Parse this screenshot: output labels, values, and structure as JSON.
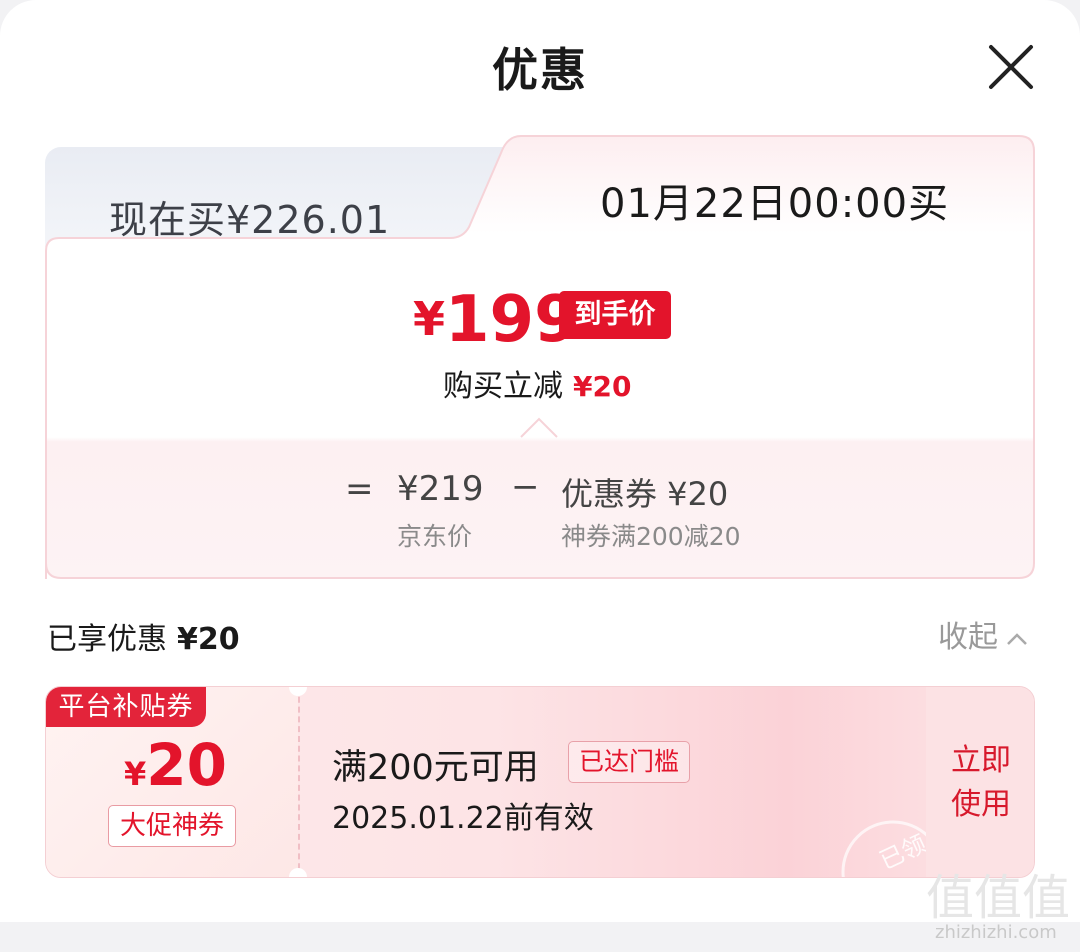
{
  "header": {
    "title": "优惠"
  },
  "price_card": {
    "now_tab": "现在买¥226.01",
    "future_tab": "01月22日00:00买",
    "final_price_symbol": "¥",
    "final_price": "199",
    "final_badge": "到手价",
    "reduce_label": "购买立减",
    "reduce_amount": "¥20",
    "breakdown": {
      "equals": "=",
      "minus": "−",
      "jd_price": "¥219",
      "jd_label": "京东价",
      "coupon_value": "优惠券 ¥20",
      "coupon_label": "神券满200减20"
    }
  },
  "enjoyed": {
    "label": "已享优惠",
    "amount": "¥20",
    "collapse_label": "收起"
  },
  "coupon": {
    "tag": "平台补贴券",
    "amount_symbol": "¥",
    "amount": "20",
    "kind": "大促神券",
    "condition": "满200元可用",
    "reached_badge": "已达门槛",
    "validity": "2025.01.22前有效",
    "stamp": "已领",
    "use_button": "立即使用"
  },
  "watermark": {
    "text": "zhizhizhi.com",
    "glyphs": "值值值"
  },
  "colors": {
    "accent_red": "#e3142b",
    "pink_bg": "#fdeaea"
  }
}
